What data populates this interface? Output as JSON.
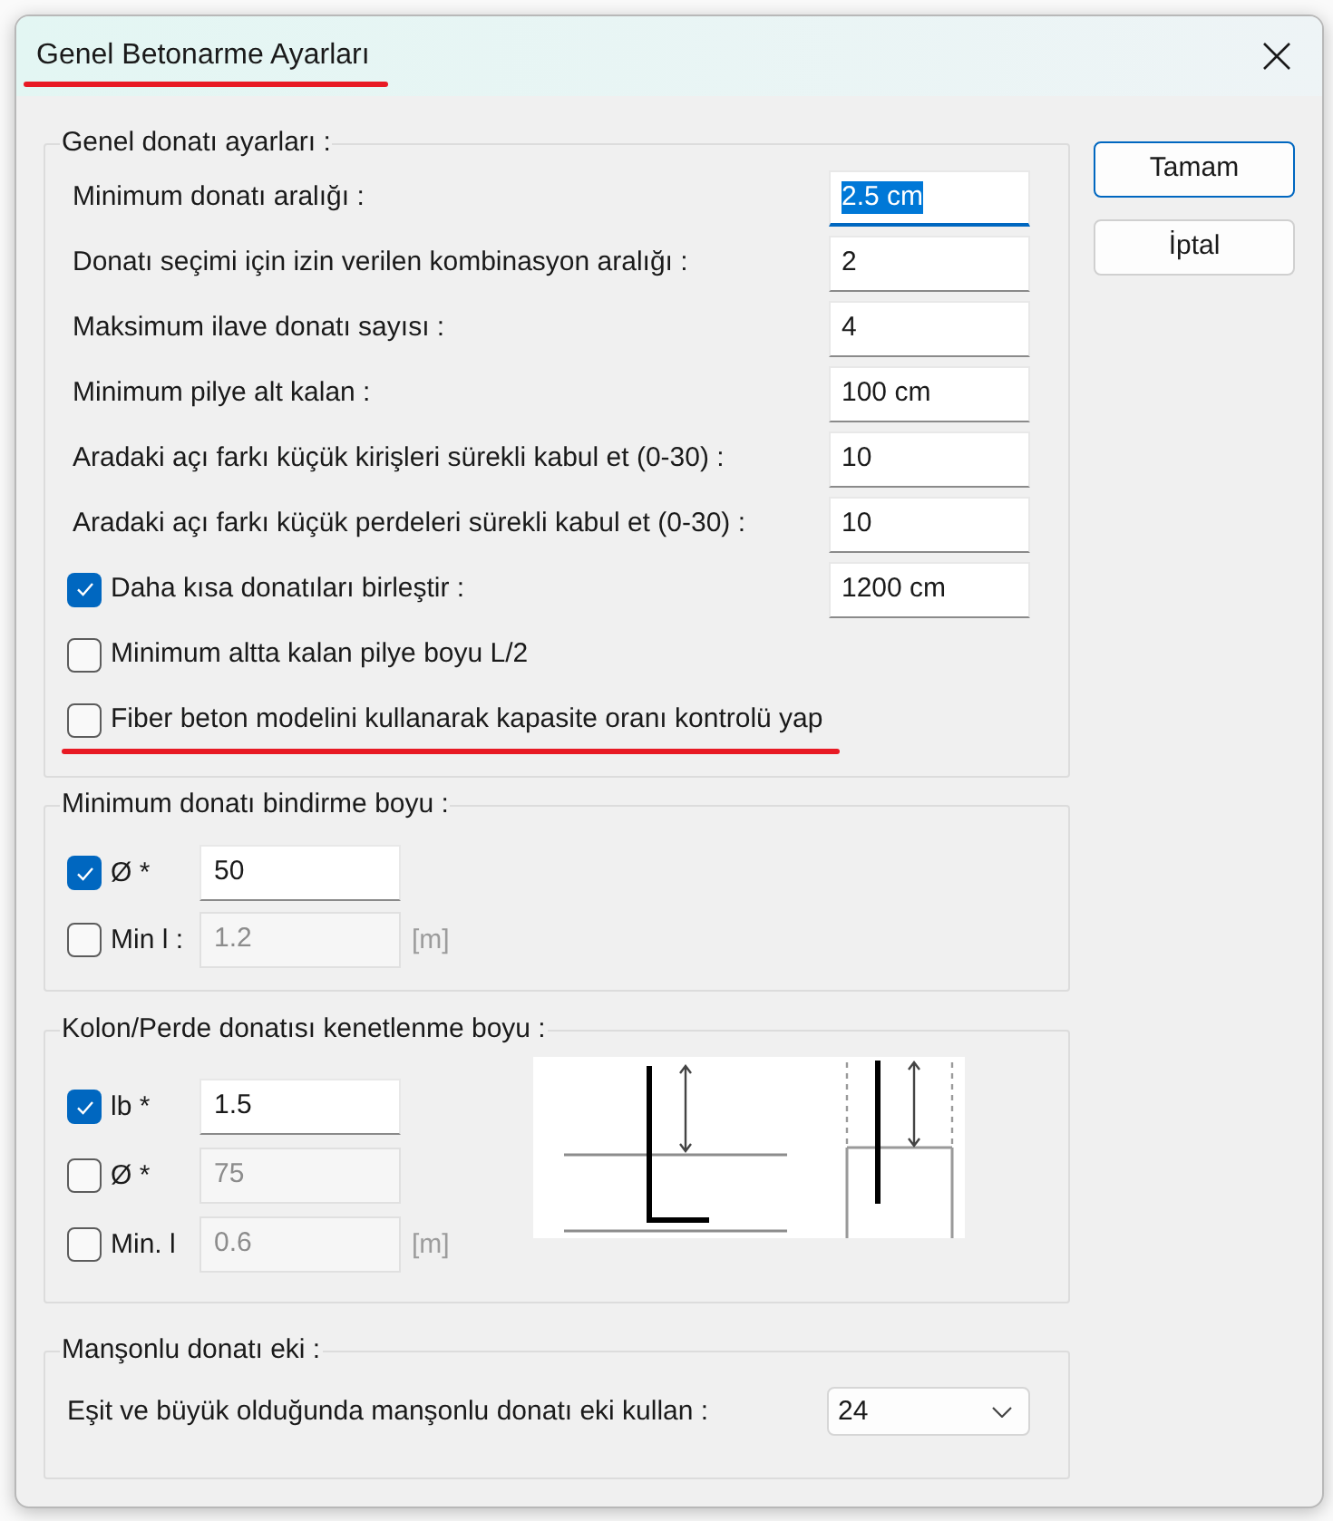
{
  "window": {
    "title": "Genel Betonarme Ayarları",
    "underlined": true
  },
  "general": {
    "legend": "Genel donatı ayarları :",
    "rows": [
      {
        "kind": "field",
        "label": "Minimum donatı aralığı :",
        "value": "2.5 cm",
        "focused": true,
        "underlined": false
      },
      {
        "kind": "field",
        "label": "Donatı seçimi için izin verilen kombinasyon aralığı :",
        "value": "2",
        "focused": false,
        "underlined": false
      },
      {
        "kind": "field",
        "label": "Maksimum ilave donatı sayısı :",
        "value": "4",
        "focused": false,
        "underlined": false
      },
      {
        "kind": "field",
        "label": "Minimum pilye alt kalan :",
        "value": "100 cm",
        "focused": false,
        "underlined": false
      },
      {
        "kind": "field",
        "label": "Aradaki açı farkı küçük kirişleri sürekli kabul et (0-30) :",
        "value": "10",
        "focused": false,
        "underlined": false
      },
      {
        "kind": "field",
        "label": "Aradaki açı farkı küçük perdeleri sürekli kabul et (0-30) :",
        "value": "10",
        "focused": false,
        "underlined": false
      },
      {
        "kind": "check_field",
        "label": "Daha kısa donatıları birleştir :",
        "checked": true,
        "value": "1200 cm",
        "focused": false,
        "underlined": false
      },
      {
        "kind": "check",
        "label": "Minimum altta kalan pilye boyu L/2",
        "checked": false,
        "underlined": false
      },
      {
        "kind": "check",
        "label": "Fiber beton modelini kullanarak kapasite oranı kontrolü yap",
        "checked": false,
        "underlined": true
      }
    ]
  },
  "lap_length": {
    "legend": "Minimum donatı bindirme boyu :",
    "rows": [
      {
        "label": "Ø *",
        "checked": true,
        "value": "50",
        "disabled": false
      },
      {
        "label": "Min l :",
        "checked": false,
        "value": "1.2",
        "disabled": true,
        "unit": "[m]"
      }
    ]
  },
  "anchorage": {
    "legend": "Kolon/Perde donatısı kenetlenme boyu :",
    "rows": [
      {
        "label": "lb *",
        "checked": true,
        "value": "1.5",
        "disabled": false
      },
      {
        "label": "Ø *",
        "checked": false,
        "value": "75",
        "disabled": true
      },
      {
        "label": "Min. l",
        "checked": false,
        "value": "0.6",
        "disabled": true,
        "unit": "[m]"
      }
    ]
  },
  "coupler": {
    "legend": "Manşonlu donatı eki :",
    "label": "Eşit ve büyük olduğunda manşonlu donatı eki kullan :",
    "value": "24"
  },
  "buttons": [
    {
      "label": "Tamam",
      "default": true
    },
    {
      "label": "İptal",
      "default": false
    }
  ]
}
